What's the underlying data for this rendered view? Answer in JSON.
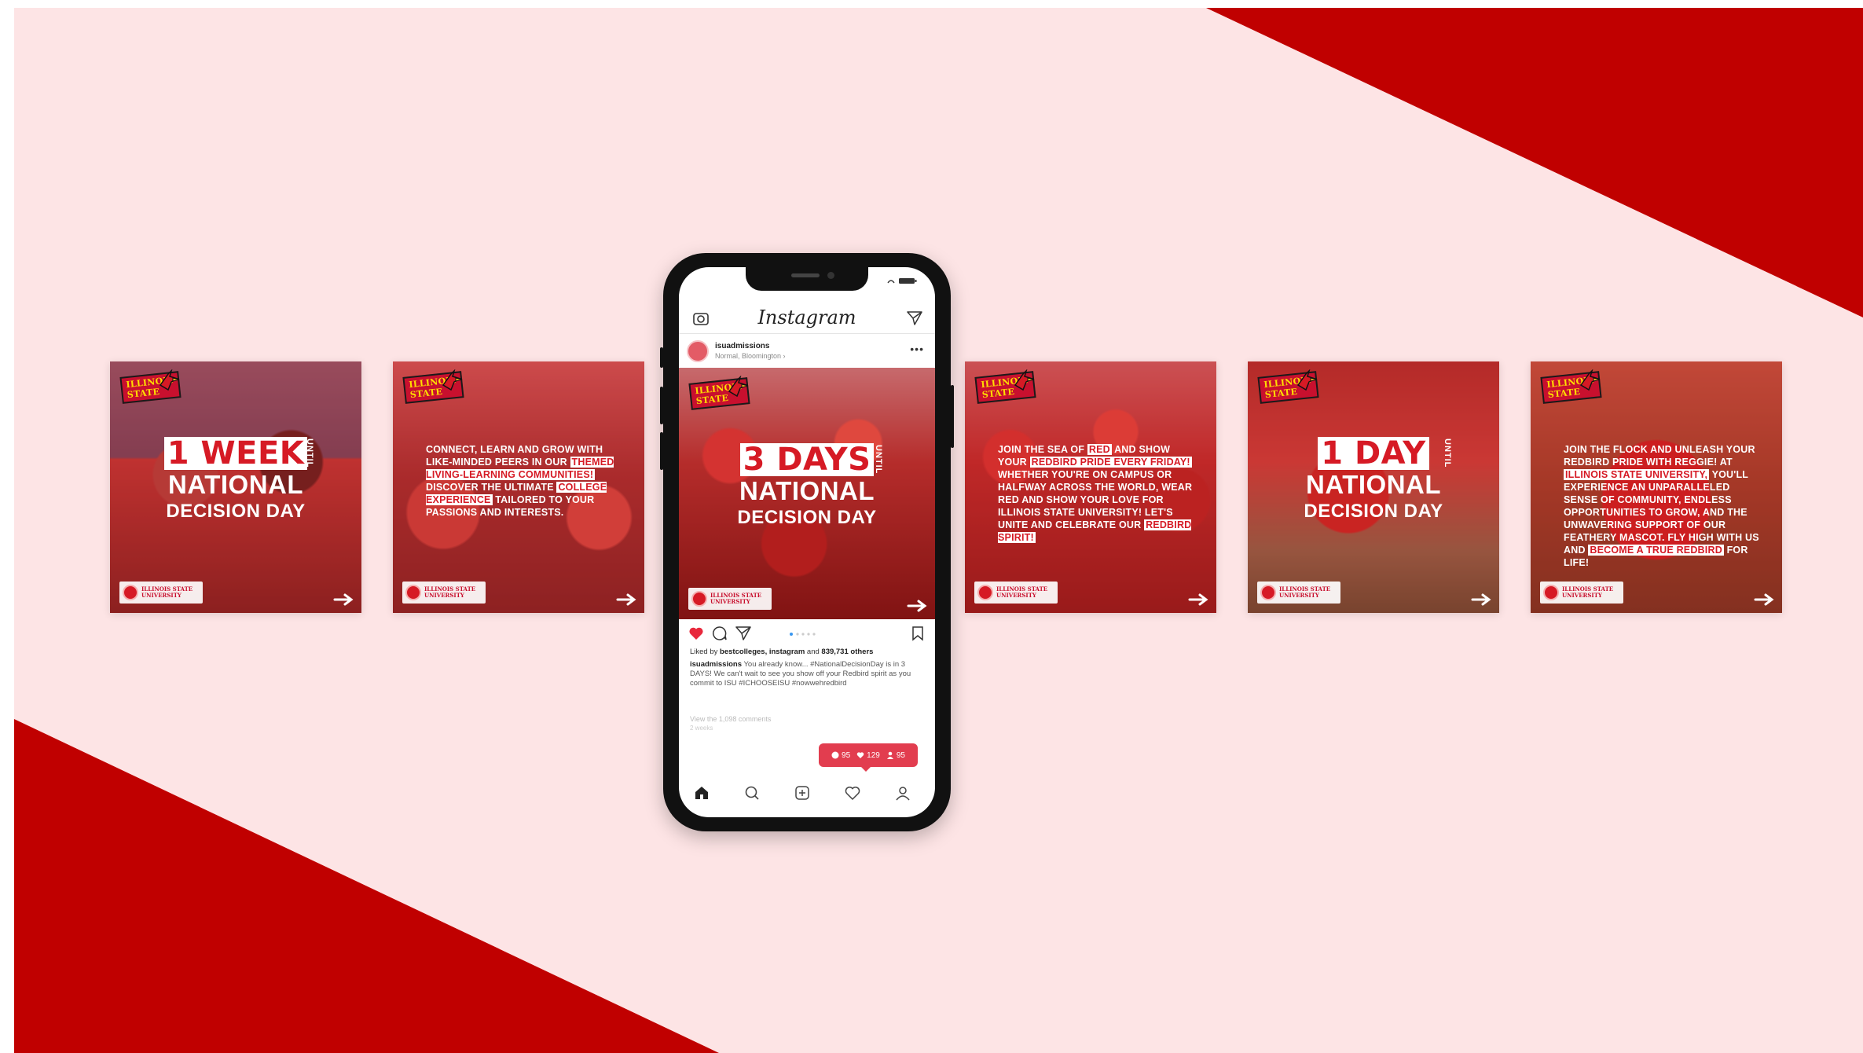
{
  "colors": {
    "background_light": "#fde4e5",
    "accent_red": "#c00000",
    "tint_red": "#d61a25",
    "highlight_white": "#ffffff",
    "notification_pink": "#e23d4f"
  },
  "tiles": [
    {
      "kind": "countdown",
      "big_number": "1 WEEK",
      "until": "UNTIL",
      "line2": "NATIONAL",
      "line3": "DECISION DAY",
      "logo_text": "ILLINOIS\nSTATE",
      "footer_text": "ILLINOIS STATE\nUNIVERSITY"
    },
    {
      "kind": "text",
      "logo_text": "ILLINOIS\nSTATE",
      "segments": [
        {
          "t": "CONNECT, LEARN AND GROW WITH LIKE-MINDED PEERS IN OUR ",
          "h": false
        },
        {
          "t": "THEMED LIVING-LEARNING COMMUNITIES!",
          "h": true
        },
        {
          "t": " DISCOVER THE ULTIMATE ",
          "h": false
        },
        {
          "t": "COLLEGE EXPERIENCE",
          "h": true
        },
        {
          "t": " TAILORED TO YOUR PASSIONS AND INTERESTS.",
          "h": false
        }
      ],
      "footer_text": "ILLINOIS STATE\nUNIVERSITY"
    },
    {
      "kind": "text",
      "logo_text": "ILLINOIS\nSTATE",
      "segments": [
        {
          "t": "JOIN THE SEA OF ",
          "h": false
        },
        {
          "t": "RED",
          "h": true
        },
        {
          "t": " AND SHOW YOUR ",
          "h": false
        },
        {
          "t": "REDBIRD PRIDE EVERY FRIDAY!",
          "h": true
        },
        {
          "t": " WHETHER YOU'RE ON CAMPUS OR HALFWAY ACROSS THE WORLD, WEAR RED AND SHOW YOUR LOVE FOR ILLINOIS STATE UNIVERSITY! LET'S UNITE AND CELEBRATE OUR ",
          "h": false
        },
        {
          "t": "REDBIRD SPIRIT!",
          "h": true
        }
      ],
      "footer_text": "ILLINOIS STATE\nUNIVERSITY"
    },
    {
      "kind": "countdown",
      "big_number": "1 DAY",
      "until": "UNTIL",
      "line2": "NATIONAL",
      "line3": "DECISION DAY",
      "logo_text": "ILLINOIS\nSTATE",
      "footer_text": "ILLINOIS STATE\nUNIVERSITY"
    },
    {
      "kind": "text",
      "logo_text": "ILLINOIS\nSTATE",
      "segments": [
        {
          "t": "JOIN THE FLOCK AND UNLEASH YOUR REDBIRD PRIDE WITH REGGIE! AT ",
          "h": false
        },
        {
          "t": "ILLINOIS STATE UNIVERSITY,",
          "h": true
        },
        {
          "t": " YOU'LL EXPERIENCE AN UNPARALLELED SENSE OF COMMUNITY, ENDLESS OPPORTUNITIES TO GROW, AND THE UNWAVERING SUPPORT OF OUR FEATHERY MASCOT. FLY HIGH WITH US AND ",
          "h": false
        },
        {
          "t": "BECOME A TRUE REDBIRD",
          "h": true
        },
        {
          "t": " FOR LIFE!",
          "h": false
        }
      ],
      "footer_text": "ILLINOIS STATE\nUNIVERSITY"
    }
  ],
  "phone": {
    "app_title": "Instagram",
    "username": "isuadmissions",
    "location": "Normal, Bloomington ›",
    "more": "•••",
    "post": {
      "big_number": "3 DAYS",
      "until": "UNTIL",
      "line2": "NATIONAL",
      "line3": "DECISION DAY",
      "logo_text": "ILLINOIS\nSTATE",
      "footer_text": "ILLINOIS STATE\nUNIVERSITY"
    },
    "liked_prefix": "Liked by ",
    "liked_users": "bestcolleges, instagram",
    "liked_mid": " and ",
    "liked_count": "839,731 others",
    "caption_user": "isuadmissions",
    "caption_text": " You already know... #NationalDecisionDay is in 3 DAYS! We can't wait to see you show off your Redbird spirit as you commit to ISU #ICHOOSEISU #nowwehredbird",
    "view_all": "View the 1,098 comments",
    "time_ago": "2 weeks",
    "notif_comments": "95",
    "notif_likes": "129",
    "notif_follows": "95"
  }
}
